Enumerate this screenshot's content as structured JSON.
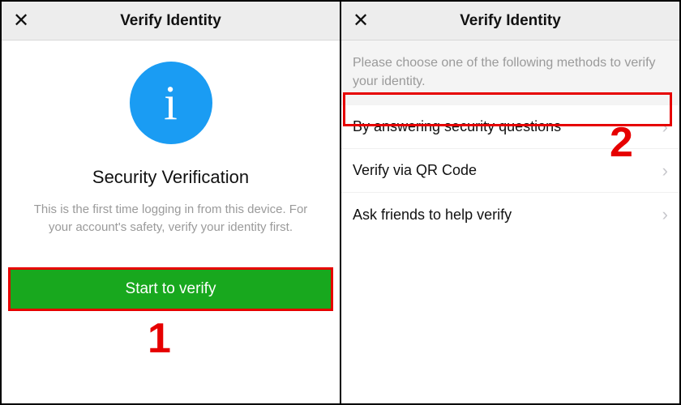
{
  "left": {
    "header_title": "Verify Identity",
    "close_glyph": "✕",
    "icon_glyph": "i",
    "title": "Security Verification",
    "subtitle": "This is the first time logging in from this device. For your account's safety, verify your identity first.",
    "cta": "Start to verify",
    "step_label": "1"
  },
  "right": {
    "header_title": "Verify Identity",
    "close_glyph": "✕",
    "instruction": "Please choose one of the following methods to verify your identity.",
    "options": [
      {
        "label": "By answering security questions",
        "chev": "›"
      },
      {
        "label": "Verify via QR Code",
        "chev": "›"
      },
      {
        "label": "Ask friends to help verify",
        "chev": "›"
      }
    ],
    "step_label": "2"
  },
  "colors": {
    "accent_green": "#18a81e",
    "info_blue": "#1a9cf3",
    "annotation_red": "#e60000"
  }
}
